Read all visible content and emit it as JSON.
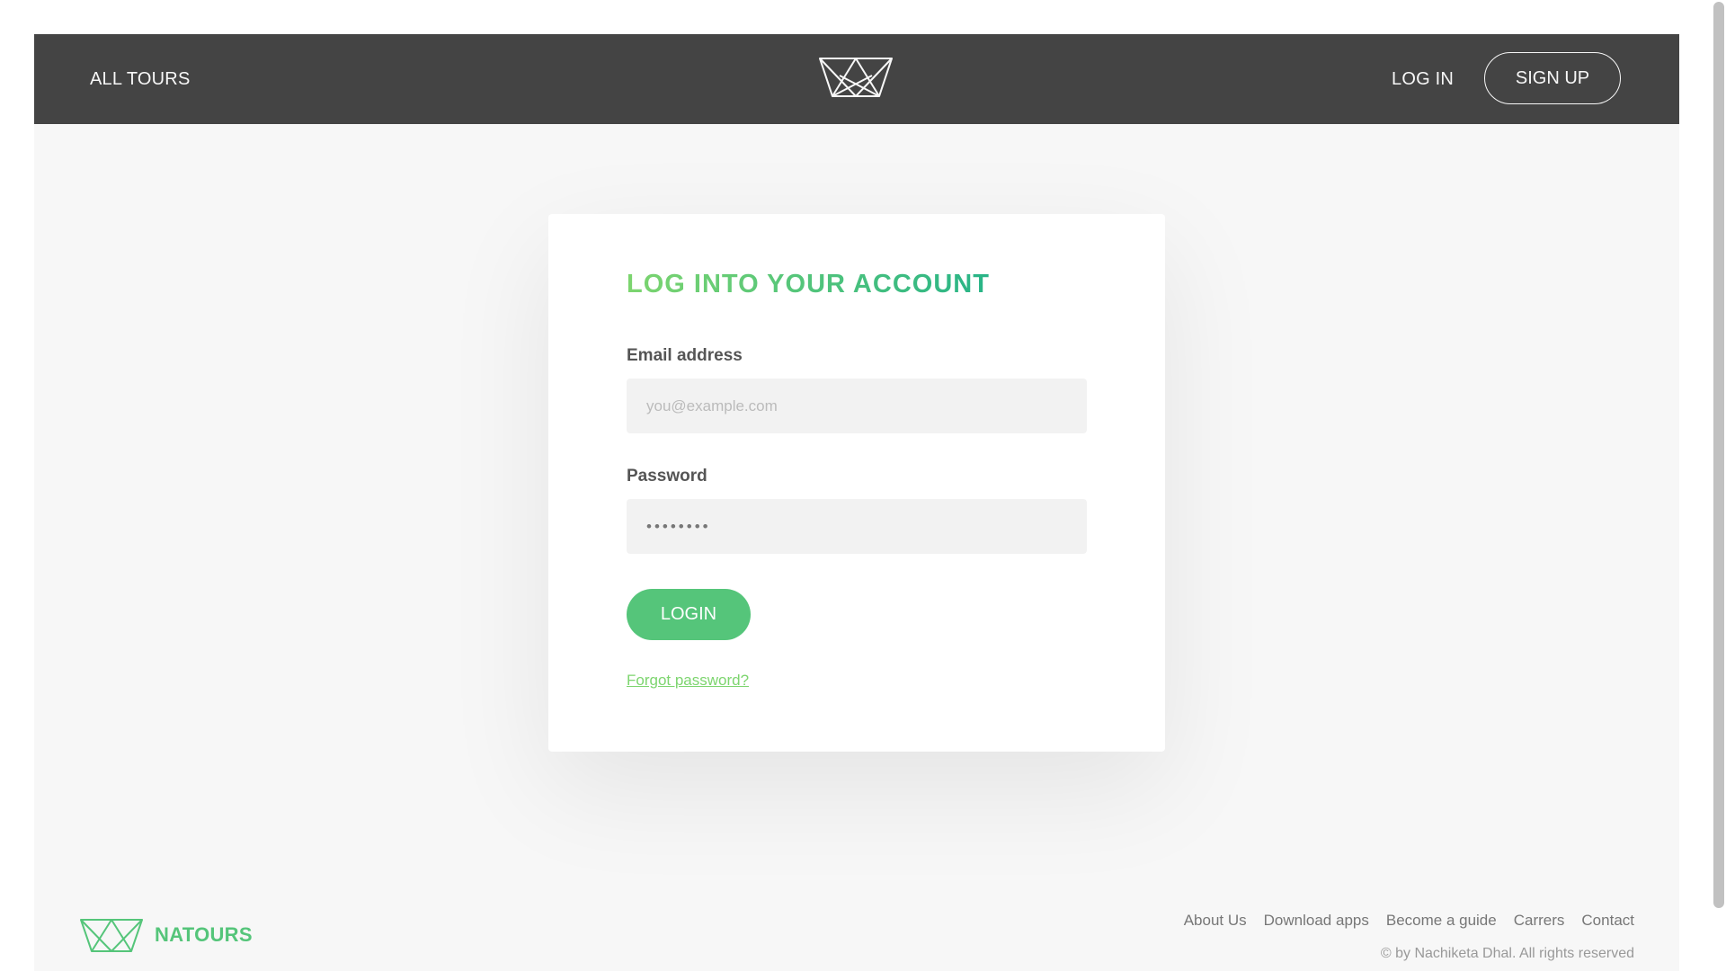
{
  "header": {
    "all_tours": "All tours",
    "login": "Log in",
    "signup": "Sign up",
    "logo_icon": "natours-crown-logo-white"
  },
  "login_form": {
    "heading": "Log into your account",
    "email_label": "Email address",
    "email_placeholder": "you@example.com",
    "email_value": "",
    "password_label": "Password",
    "password_value": "••••••••",
    "submit_label": "Login",
    "forgot_link": "Forgot password?"
  },
  "footer": {
    "logo_icon": "natours-crown-logo-green",
    "brand": "Natours",
    "links": [
      "About Us",
      "Download apps",
      "Become a guide",
      "Carrers",
      "Contact"
    ],
    "copyright": "© by Nachiketa Dhal. All rights reserved"
  },
  "colors": {
    "header_bg": "#444444",
    "primary_green": "#55c57a",
    "gradient_start": "#7dd56f",
    "gradient_end": "#28b487",
    "page_bg": "#f7f7f7"
  }
}
